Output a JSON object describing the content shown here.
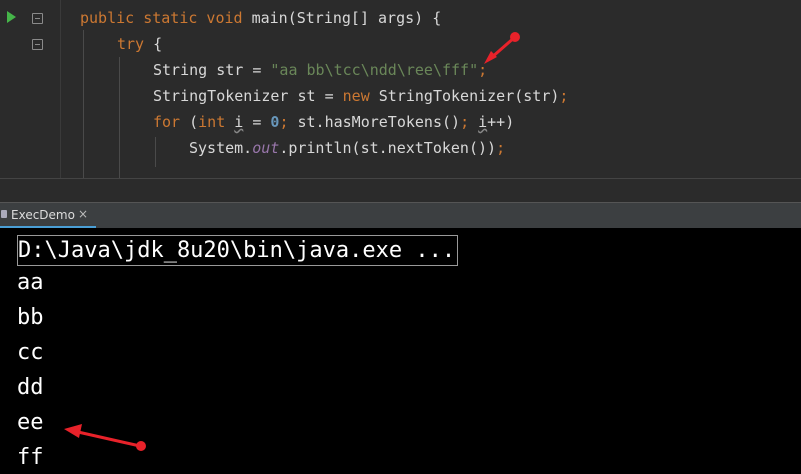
{
  "editor": {
    "lines": [
      [
        {
          "t": "public static void ",
          "c": "kw"
        },
        {
          "t": "main(String[] args) {",
          "c": ""
        }
      ],
      [
        {
          "t": "try ",
          "c": "kw"
        },
        {
          "t": "{",
          "c": ""
        }
      ],
      [
        {
          "t": "String str = ",
          "c": ""
        },
        {
          "t": "\"aa bb\\tcc\\ndd\\ree\\fff\"",
          "c": "str"
        },
        {
          "t": ";",
          "c": "kw"
        }
      ],
      [
        {
          "t": "StringTokenizer st = ",
          "c": ""
        },
        {
          "t": "new ",
          "c": "kw"
        },
        {
          "t": "StringTokenizer(str)",
          "c": ""
        },
        {
          "t": ";",
          "c": "kw"
        }
      ],
      [
        {
          "t": "for ",
          "c": "kw"
        },
        {
          "t": "(",
          "c": ""
        },
        {
          "t": "int ",
          "c": "kw"
        },
        {
          "t": "i",
          "c": "uvar"
        },
        {
          "t": " = ",
          "c": ""
        },
        {
          "t": "0",
          "c": "num"
        },
        {
          "t": "; ",
          "c": "kw"
        },
        {
          "t": "st.hasMoreTokens()",
          "c": ""
        },
        {
          "t": "; ",
          "c": "kw"
        },
        {
          "t": "i",
          "c": "uvar"
        },
        {
          "t": "++)",
          "c": ""
        }
      ],
      [
        {
          "t": "System.",
          "c": ""
        },
        {
          "t": "out",
          "c": "fld"
        },
        {
          "t": ".println(st.nextToken())",
          "c": ""
        },
        {
          "t": ";",
          "c": "kw"
        }
      ]
    ]
  },
  "run_tab": {
    "label": "ExecDemo",
    "close": "×"
  },
  "console": {
    "command": "D:\\Java\\jdk_8u20\\bin\\java.exe ...",
    "output": [
      "aa",
      "bb",
      "cc",
      "dd",
      "ee",
      "ff"
    ]
  },
  "colors": {
    "annotation_arrow": "#e8222a",
    "tab_underline": "#4a9fd6"
  },
  "icons": [
    "run-icon",
    "fold-icon",
    "close-icon",
    "annotation-arrow"
  ]
}
